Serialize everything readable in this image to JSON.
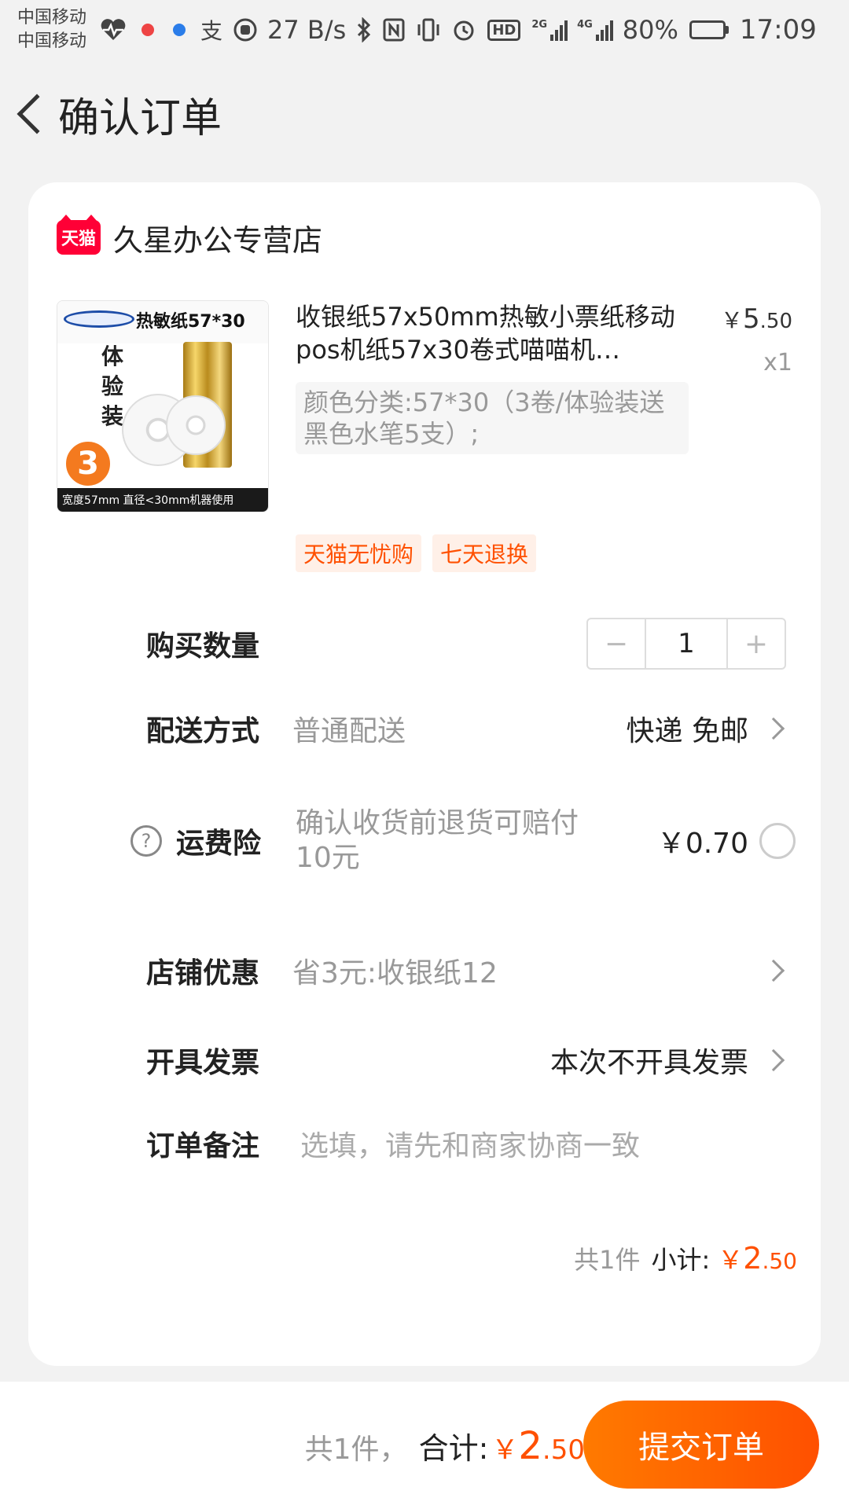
{
  "status_bar": {
    "carrier_1": "中国移动",
    "carrier_2": "中国移动",
    "net_speed": "27 B/s",
    "net_2g": "2G",
    "net_4g": "4G",
    "battery_text": "80%",
    "battery_level": 0.8,
    "time": "17:09"
  },
  "nav": {
    "title": "确认订单",
    "back_icon": "chevron-left-icon"
  },
  "shop": {
    "badge": "天猫",
    "name": "久星办公专营店"
  },
  "product": {
    "image": {
      "title": "热敏纸57*30",
      "side": "体验装",
      "count": "3",
      "footer": "宽度57mm  直径<30mm机器使用"
    },
    "title": "收银纸57x50mm热敏小票纸移动pos机纸57x30卷式喵喵机…",
    "price_symbol": "￥",
    "price_int": "5",
    "price_dec": ".50",
    "quantity": "x1",
    "sku": "颜色分类:57*30（3卷/体验装送黑色水笔5支）;",
    "tags": [
      "天猫无忧购",
      "七天退换"
    ]
  },
  "quantity_row": {
    "label": "购买数量",
    "minus": "−",
    "value": "1",
    "plus": "+"
  },
  "delivery_row": {
    "label": "配送方式",
    "sub": "普通配送",
    "value": "快递 免邮"
  },
  "insurance_row": {
    "label": "运费险",
    "help": "?",
    "desc": "确认收货前退货可赔付10元",
    "price": "￥0.70"
  },
  "discount_row": {
    "label": "店铺优惠",
    "sub": "省3元:收银纸12"
  },
  "invoice_row": {
    "label": "开具发票",
    "value": "本次不开具发票"
  },
  "note_row": {
    "label": "订单备注",
    "placeholder": "选填，请先和商家协商一致"
  },
  "subtotal": {
    "count": "共1件",
    "label": "小计:",
    "symbol": "￥",
    "int": "2",
    "dec": ".50"
  },
  "footer": {
    "count": "共1件，",
    "label": "合计:",
    "symbol": "￥",
    "int": "2",
    "dec": ".50",
    "submit": "提交订单"
  },
  "colors": {
    "accent": "#ff5000",
    "tmall": "#ff0036",
    "background": "#f2f2f2"
  }
}
